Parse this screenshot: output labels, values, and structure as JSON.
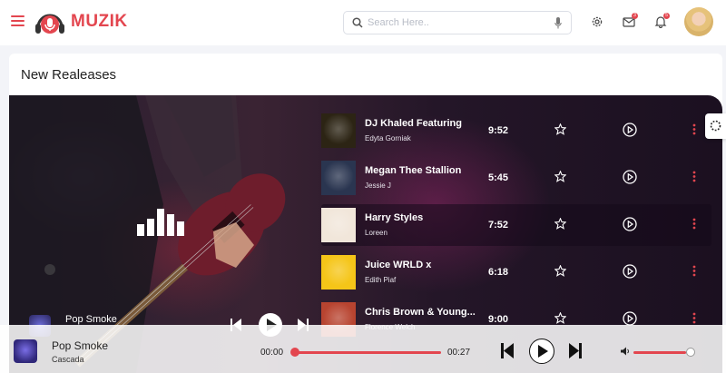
{
  "app": {
    "name": "MUZIK"
  },
  "search": {
    "placeholder": "Search Here.."
  },
  "header": {
    "mail_badge": "3",
    "bell_badge": "5"
  },
  "page": {
    "title": "New Realeases"
  },
  "mini_player": {
    "title": "Pop Smoke"
  },
  "tracks": [
    {
      "title": "DJ Khaled Featuring",
      "artist": "Edyta Gorniak",
      "duration": "9:52",
      "thumb_color": "#2c2414"
    },
    {
      "title": "Megan Thee Stallion",
      "artist": "Jessie J",
      "duration": "5:45",
      "thumb_color": "#2a3550"
    },
    {
      "title": "Harry Styles",
      "artist": "Loreen",
      "duration": "7:52",
      "thumb_color": "#f1e6da"
    },
    {
      "title": "Juice WRLD x",
      "artist": "Edith Piaf",
      "duration": "6:18",
      "thumb_color": "#f5c518"
    },
    {
      "title": "Chris Brown & Young...",
      "artist": "Florence Welch",
      "duration": "9:00",
      "thumb_color": "#b84430"
    }
  ],
  "active_track_index": 2,
  "player": {
    "title": "Pop Smoke",
    "artist": "Cascada",
    "current_time": "00:00",
    "duration": "00:27",
    "volume": 0.85
  },
  "colors": {
    "accent": "#e3464f"
  }
}
